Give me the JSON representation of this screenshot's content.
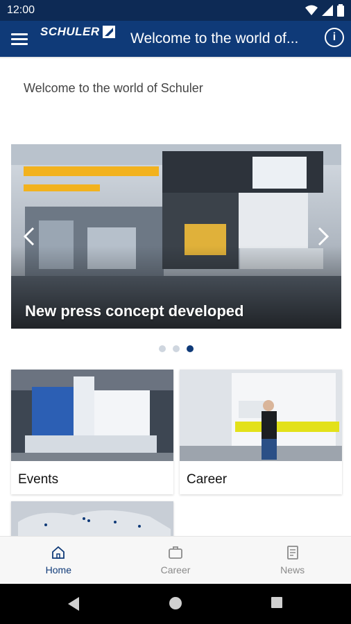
{
  "status": {
    "time": "12:00"
  },
  "header": {
    "logo_text": "SCHULER",
    "title": "Welcome to the world of..."
  },
  "intro": {
    "text": "Welcome to the world of Schuler"
  },
  "carousel": {
    "caption": "New press concept developed",
    "slide_count": 3,
    "active_index": 2
  },
  "cards": [
    {
      "label": "Events"
    },
    {
      "label": "Career"
    },
    {
      "label": ""
    }
  ],
  "bottom_nav": {
    "items": [
      {
        "label": "Home",
        "icon": "home-icon",
        "active": true
      },
      {
        "label": "Career",
        "icon": "briefcase-icon",
        "active": false
      },
      {
        "label": "News",
        "icon": "newspaper-icon",
        "active": false
      }
    ]
  },
  "colors": {
    "primary": "#0f3a78",
    "status_bar": "#0d2a55",
    "inactive": "#8a8a8a"
  }
}
